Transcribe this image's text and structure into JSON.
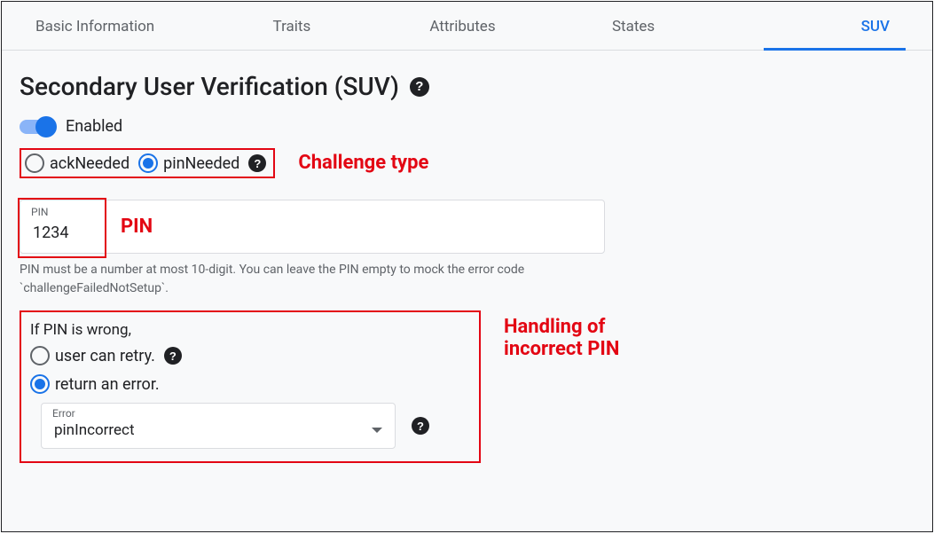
{
  "tabs": {
    "basic": "Basic Information",
    "traits": "Traits",
    "attributes": "Attributes",
    "states": "States",
    "suv": "SUV"
  },
  "section": {
    "title": "Secondary User Verification (SUV)",
    "help": "?"
  },
  "toggle": {
    "label": "Enabled",
    "state": true
  },
  "challenge": {
    "ack_label": "ackNeeded",
    "pin_label": "pinNeeded",
    "selected": "pinNeeded",
    "help": "?",
    "annotation": "Challenge type"
  },
  "pin": {
    "field_label": "PIN",
    "value": "1234",
    "hint": "PIN must be a number at most 10-digit. You can leave the PIN empty to mock the error code `challengeFailedNotSetup`.",
    "annotation": "PIN"
  },
  "error_handling": {
    "prompt": "If PIN is wrong,",
    "retry_label": "user can retry.",
    "error_label": "return an error.",
    "selected": "return_error",
    "select_label": "Error",
    "select_value": "pinIncorrect",
    "help": "?",
    "annotation_line1": "Handling of",
    "annotation_line2": "incorrect PIN"
  }
}
